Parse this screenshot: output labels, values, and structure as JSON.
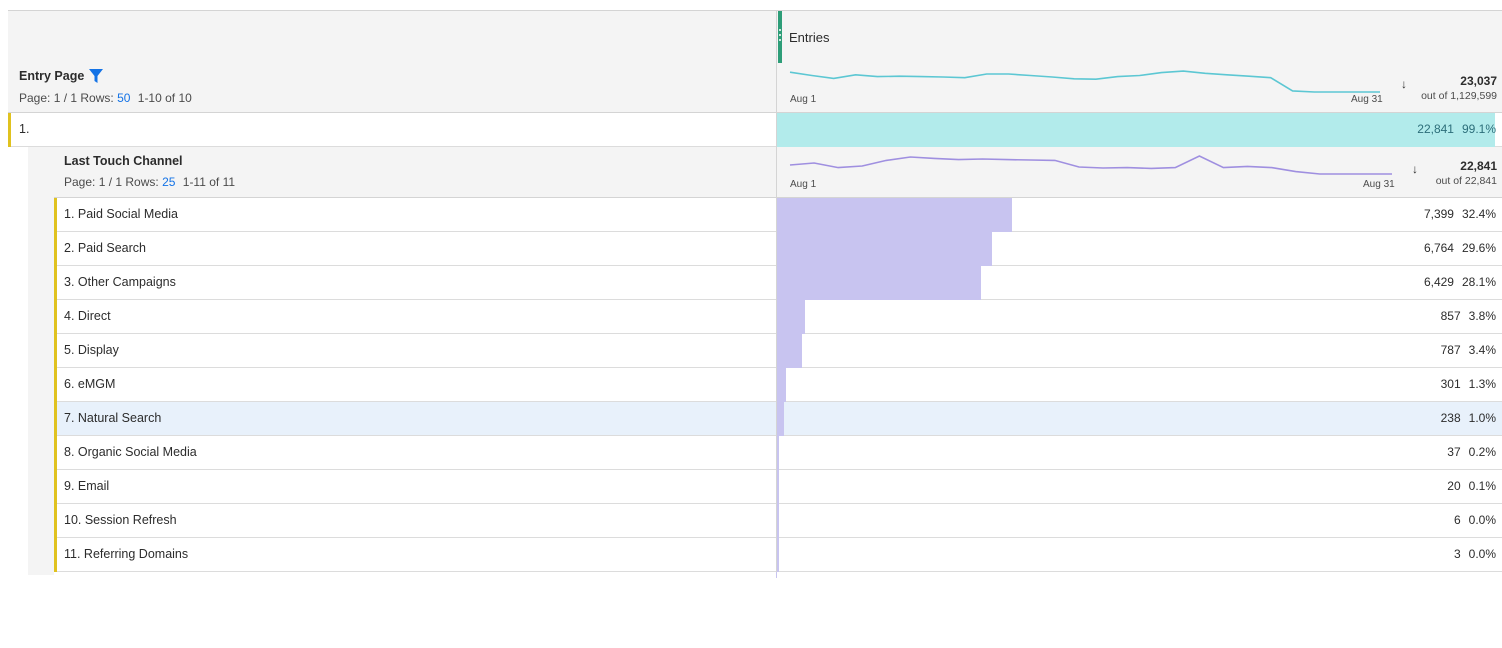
{
  "metric": {
    "title": "Entries"
  },
  "entry_page": {
    "name": "Entry Page",
    "page_label": "Page: 1 / 1  Rows:",
    "rows_value": "50",
    "range": "1-10 of 10",
    "spark_start": "Aug 1",
    "spark_end": "Aug 31",
    "total": "23,037",
    "out_of": "out of 1,129,599",
    "spark": [
      0.1,
      0.25,
      0.38,
      0.22,
      0.3,
      0.28,
      0.3,
      0.32,
      0.35,
      0.18,
      0.18,
      0.25,
      0.32,
      0.4,
      0.42,
      0.3,
      0.25,
      0.12,
      0.05,
      0.15,
      0.22,
      0.28,
      0.35,
      0.95,
      1.0,
      1.0,
      1.0,
      1.0
    ],
    "row1": {
      "label": "1.",
      "value": "22,841",
      "pct": "99.1%",
      "fraction": 0.991
    }
  },
  "channel": {
    "name": "Last Touch Channel",
    "page_label": "Page: 1 / 1  Rows:",
    "rows_value": "25",
    "range": "1-11 of 11",
    "spark_start": "Aug 1",
    "spark_end": "Aug 31",
    "total": "22,841",
    "out_of": "out of 22,841",
    "spark": [
      0.45,
      0.35,
      0.58,
      0.5,
      0.22,
      0.05,
      0.12,
      0.18,
      0.15,
      0.18,
      0.2,
      0.22,
      0.55,
      0.6,
      0.58,
      0.62,
      0.58,
      0.0,
      0.58,
      0.52,
      0.58,
      0.78,
      0.9,
      0.9,
      0.9,
      0.9
    ],
    "rows": [
      {
        "label": "1.  Paid Social Media",
        "value": "7,399",
        "pct": "32.4%",
        "fraction": 0.324,
        "highlight": false
      },
      {
        "label": "2.  Paid Search",
        "value": "6,764",
        "pct": "29.6%",
        "fraction": 0.296,
        "highlight": false
      },
      {
        "label": "3.  Other Campaigns",
        "value": "6,429",
        "pct": "28.1%",
        "fraction": 0.281,
        "highlight": false
      },
      {
        "label": "4.  Direct",
        "value": "857",
        "pct": "3.8%",
        "fraction": 0.038,
        "highlight": false
      },
      {
        "label": "5.  Display",
        "value": "787",
        "pct": "3.4%",
        "fraction": 0.034,
        "highlight": false
      },
      {
        "label": "6.  eMGM",
        "value": "301",
        "pct": "1.3%",
        "fraction": 0.013,
        "highlight": false
      },
      {
        "label": "7.  Natural Search",
        "value": "238",
        "pct": "1.0%",
        "fraction": 0.01,
        "highlight": true
      },
      {
        "label": "8.  Organic Social Media",
        "value": "37",
        "pct": "0.2%",
        "fraction": 0.002,
        "highlight": false
      },
      {
        "label": "9.  Email",
        "value": "20",
        "pct": "0.1%",
        "fraction": 0.001,
        "highlight": false
      },
      {
        "label": "10.  Session Refresh",
        "value": "6",
        "pct": "0.0%",
        "fraction": 0.0,
        "highlight": false
      },
      {
        "label": "11.  Referring Domains",
        "value": "3",
        "pct": "0.0%",
        "fraction": 0.0,
        "highlight": false
      }
    ]
  },
  "colors": {
    "entry_bar": "#b2ebeb",
    "entry_spark": "#5cc7d3",
    "channel_bar": "#c8c4f0",
    "channel_spark": "#9f8fe0",
    "accent": "#e0c21f",
    "metric_handle": "#2d9d78",
    "filter_icon": "#1473e6"
  },
  "icons": {
    "filter": "filter-icon",
    "sort": "sort-descending-icon",
    "handle": "drag-handle-icon"
  }
}
